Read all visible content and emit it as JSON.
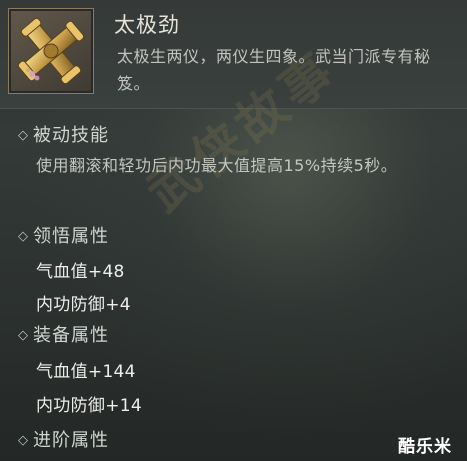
{
  "skill": {
    "icon": "golden-scroll-cross-icon",
    "name": "太极劲",
    "description": "太极生两仪，两仪生四象。武当门派专有秘笈。"
  },
  "sections": {
    "passive": {
      "label": "被动技能",
      "text": "使用翻滚和轻功后内功最大值提高15%持续5秒。"
    },
    "comprehension": {
      "label": "领悟属性",
      "stats": [
        "气血值+48",
        "内功防御+4"
      ]
    },
    "equipment": {
      "label": "装备属性",
      "stats": [
        "气血值+144",
        "内功防御+14"
      ]
    },
    "advanced": {
      "label": "进阶属性"
    }
  },
  "watermark": "武侠故事",
  "brand": "酷乐米",
  "colors": {
    "background": "#343a38",
    "title": "#e4e2d9",
    "stat": "#eeeeea"
  }
}
